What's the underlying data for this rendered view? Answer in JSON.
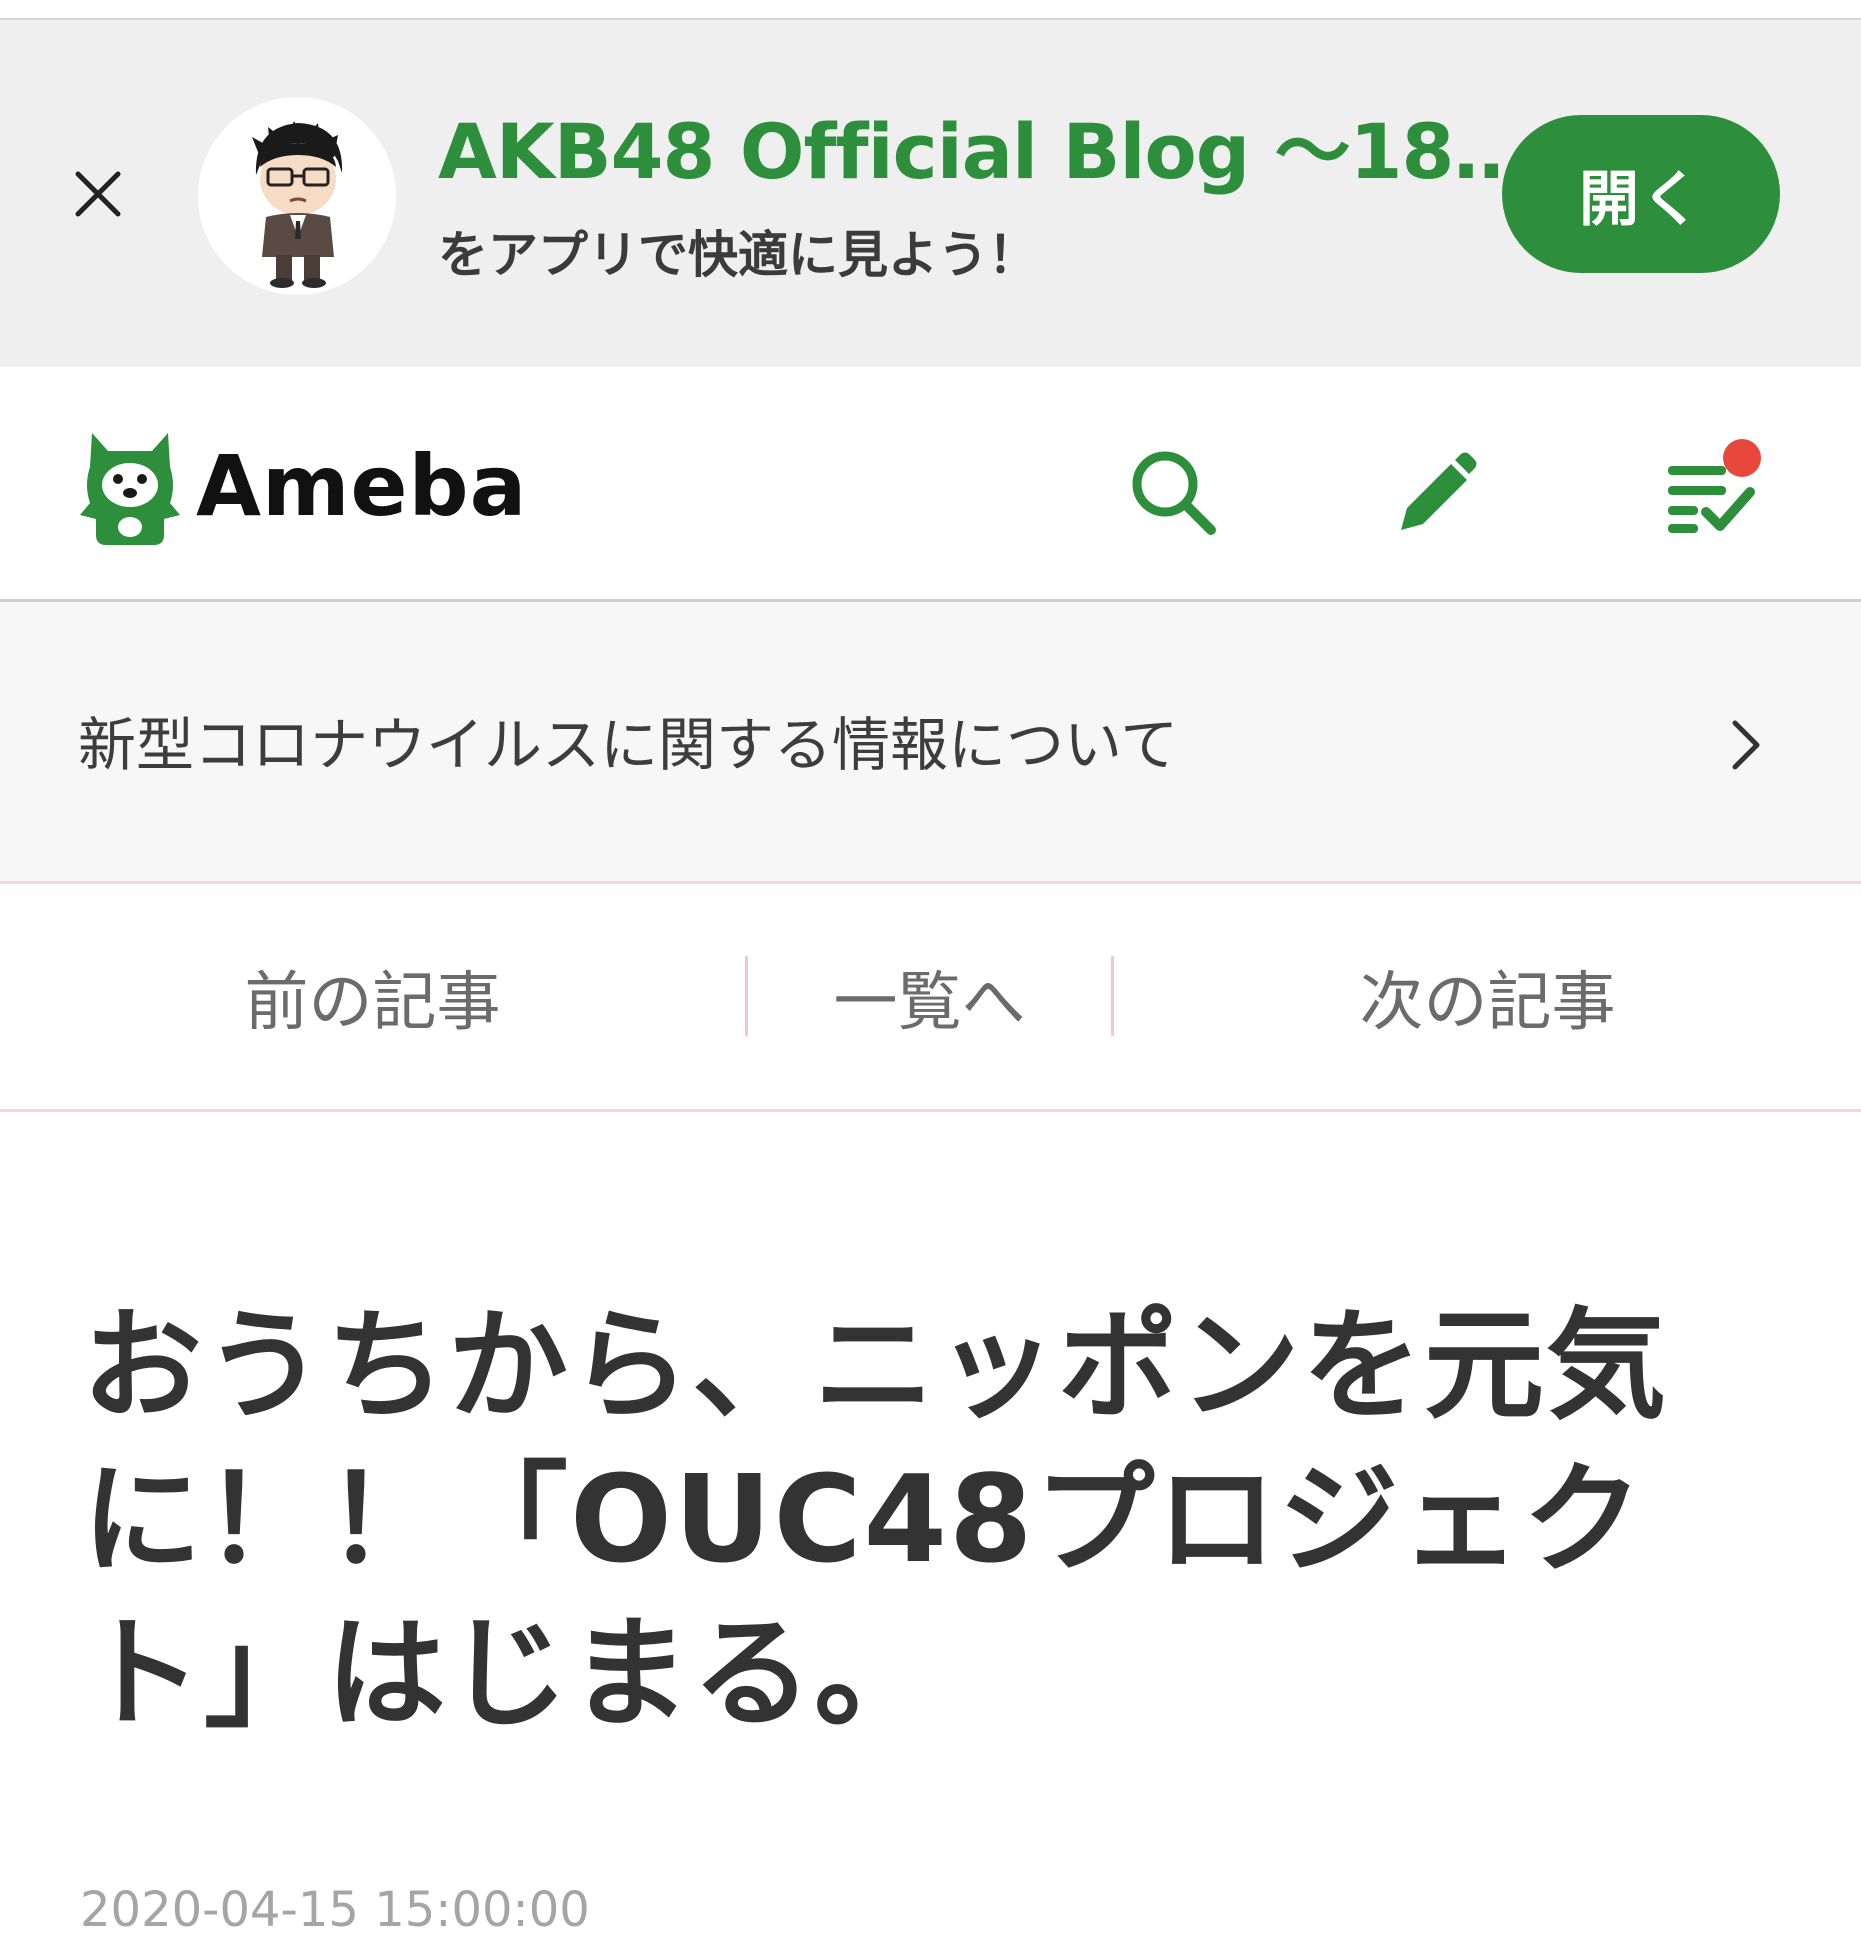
{
  "app_banner": {
    "close_label": "×",
    "title": "AKB48 Official Blog ～18…",
    "subtitle": "をアプリで快適に見よう！",
    "open_button": "開く"
  },
  "header": {
    "logo_text": "Ameba",
    "icons": [
      "search-icon",
      "pencil-icon",
      "checklist-icon"
    ],
    "accent_color": "#2d8f3b",
    "notification_color": "#e8473c"
  },
  "notice": {
    "text": "新型コロナウイルスに関する情報について",
    "chevron": "›"
  },
  "article_nav": {
    "prev": "前の記事",
    "list": "一覧へ",
    "next": "次の記事"
  },
  "article": {
    "title": "おうちから、ニッポンを元気に！！「OUC48プロジェクト」はじまる。",
    "date": "2020-04-15 15:00:00"
  }
}
